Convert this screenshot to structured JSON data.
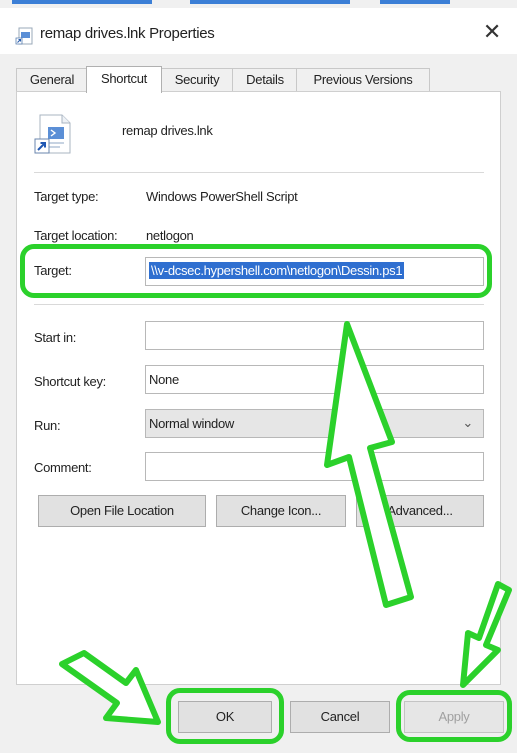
{
  "window": {
    "title": "remap drives.lnk Properties",
    "close_glyph": "✕"
  },
  "tabs": [
    {
      "label": "General",
      "active": false
    },
    {
      "label": "Shortcut",
      "active": true
    },
    {
      "label": "Security",
      "active": false
    },
    {
      "label": "Details",
      "active": false
    },
    {
      "label": "Previous Versions",
      "active": false
    }
  ],
  "file": {
    "name": "remap drives.lnk",
    "icon": "powershell-script-shortcut-icon"
  },
  "info": {
    "target_type_label": "Target type:",
    "target_type_value": "Windows PowerShell Script",
    "target_location_label": "Target location:",
    "target_location_value": "netlogon"
  },
  "fields": {
    "target_label": "Target:",
    "target_value": "\\\\v-dcsec.hypershell.com\\netlogon\\Dessin.ps1",
    "start_in_label": "Start in:",
    "start_in_value": "",
    "shortcut_key_label": "Shortcut key:",
    "shortcut_key_value": "None",
    "run_label": "Run:",
    "run_value": "Normal window",
    "comment_label": "Comment:",
    "comment_value": ""
  },
  "actions": {
    "open_file_location": "Open File Location",
    "change_icon": "Change Icon...",
    "advanced": "Advanced..."
  },
  "footer": {
    "ok": "OK",
    "cancel": "Cancel",
    "apply": "Apply"
  },
  "colors": {
    "annotation_green": "#2bd12b",
    "selection_blue": "#2f6fd0"
  }
}
